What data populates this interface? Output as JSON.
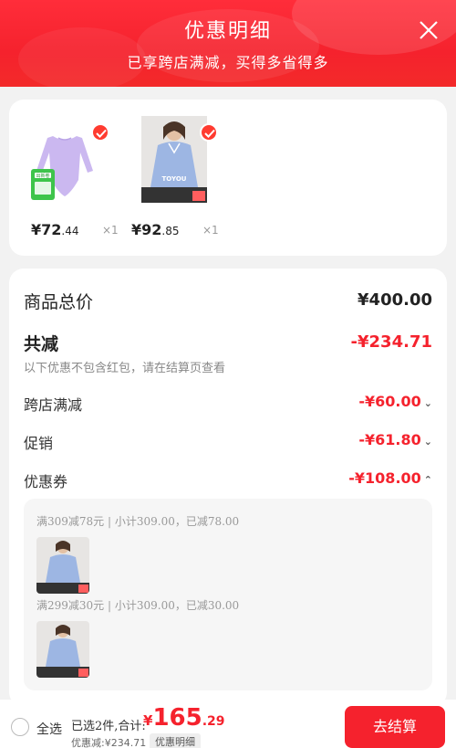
{
  "header": {
    "title": "优惠明细",
    "subtitle": "已享跨店满减，买得多省得多"
  },
  "products": [
    {
      "name": "purple-leotard",
      "price_int": "¥72",
      "price_dec": ".44",
      "qty": "×1",
      "selected": true
    },
    {
      "name": "blue-shirt",
      "price_int": "¥92",
      "price_dec": ".85",
      "qty": "×1",
      "selected": true
    }
  ],
  "product_overlay": {
    "shirt_brand": "TOYOU",
    "badge_text": "出新卷"
  },
  "summary": {
    "total_label": "商品总价",
    "total_value": "¥400.00",
    "reduce_label": "共减",
    "reduce_value": "-¥234.71",
    "note": "以下优惠不包含红包，请在结算页查看",
    "items": [
      {
        "label": "跨店满减",
        "value": "-¥60.00",
        "expanded": false
      },
      {
        "label": "促销",
        "value": "-¥61.80",
        "expanded": false
      },
      {
        "label": "优惠券",
        "value": "-¥108.00",
        "expanded": true
      }
    ]
  },
  "coupons": [
    {
      "text": "满309减78元 | 小计309.00，已减78.00"
    },
    {
      "text": "满299减30元 | 小计309.00，已减30.00"
    }
  ],
  "footer": {
    "select_all": "全选",
    "selected_info": "已选2件,合计:",
    "total_symbol": "¥",
    "total_int": "165",
    "total_dec": ".29",
    "discount_info": "优惠减:¥234.71",
    "detail_tag": "优惠明细",
    "checkout": "去结算"
  },
  "colors": {
    "accent": "#f5222d",
    "header_gradient": "#ff2d3a"
  }
}
